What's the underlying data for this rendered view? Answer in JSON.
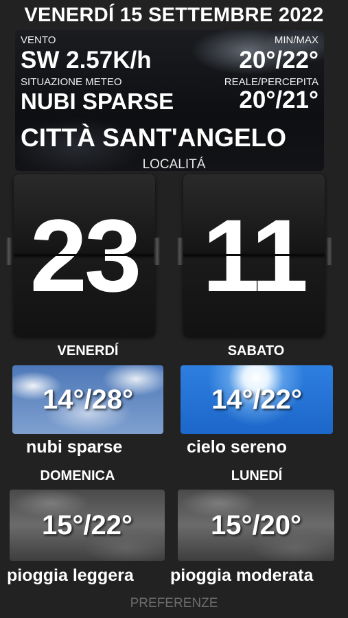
{
  "header": {
    "date": "VENERDÍ 15 SETTEMBRE 2022"
  },
  "current": {
    "wind_label": "VENTO",
    "wind_value": "SW 2.57K/h",
    "minmax_label": "MIN/MAX",
    "minmax_value": "20°/22°",
    "condition_label": "SITUAZIONE METEO",
    "condition_value": "NUBI SPARSE",
    "real_perceived_label": "REALE/PERCEPITA",
    "real_perceived_value": "20°/21°",
    "city": "CITTÀ SANT'ANGELO",
    "location_label": "LOCALITÁ"
  },
  "clock": {
    "hours": "23",
    "minutes": "11"
  },
  "forecast": [
    {
      "day": "VENERDÍ",
      "temps": "14°/28°",
      "description": "nubi sparse",
      "icon": "scattered-clouds"
    },
    {
      "day": "SABATO",
      "temps": "14°/22°",
      "description": "cielo sereno",
      "icon": "clear-sky"
    },
    {
      "day": "DOMENICA",
      "temps": "15°/22°",
      "description": "pioggia leggera",
      "icon": "light-rain"
    },
    {
      "day": "LUNEDÍ",
      "temps": "15°/20°",
      "description": "pioggia moderata",
      "icon": "moderate-rain"
    }
  ],
  "footer": {
    "preferences_label": "PREFERENZE"
  }
}
